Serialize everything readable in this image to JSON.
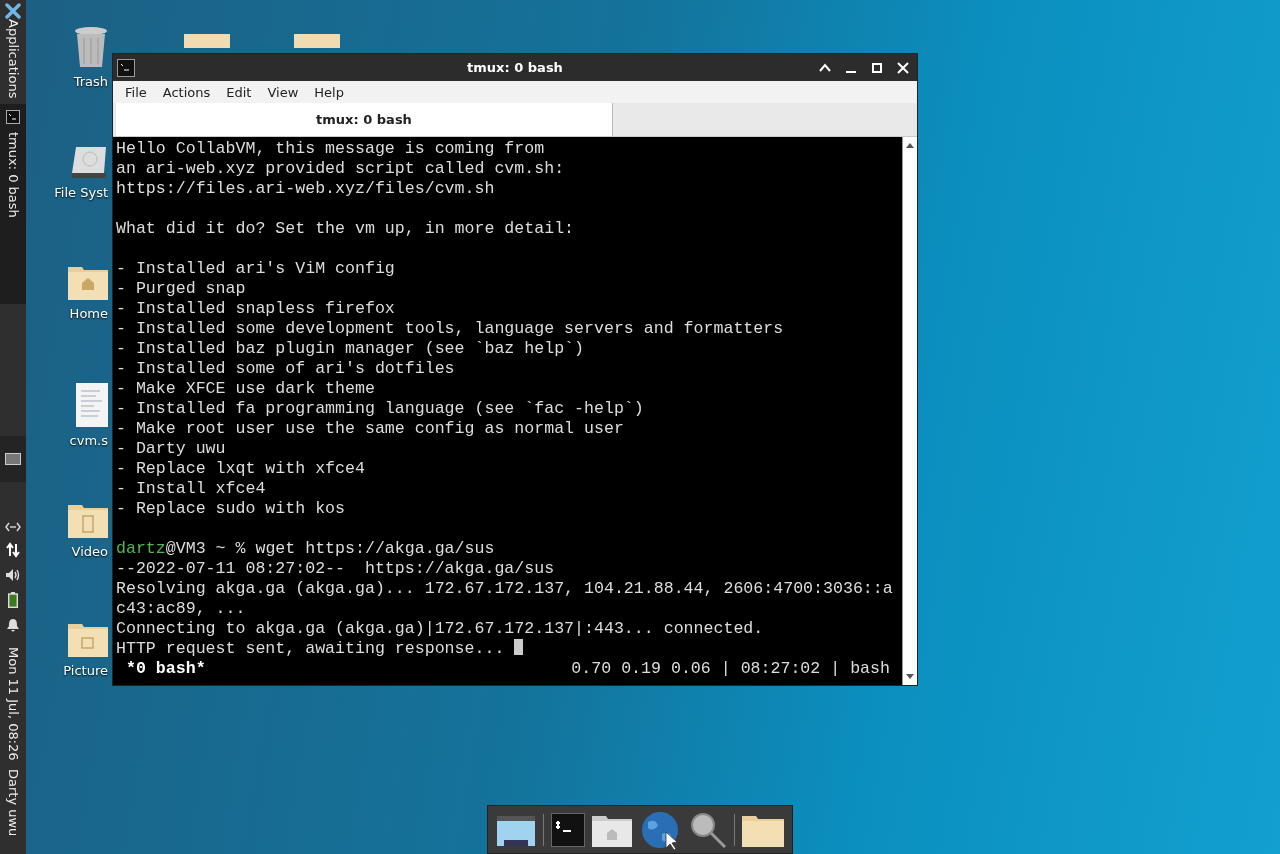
{
  "panel": {
    "menu_label": "Applications",
    "task_label": "tmux: 0 bash",
    "clock": "Mon 11 Jul, 08:26",
    "user": "Darty uwu"
  },
  "desktop_icons": [
    {
      "kind": "trash",
      "label": "Trash"
    },
    {
      "kind": "drive",
      "label": "File Syst"
    },
    {
      "kind": "home",
      "label": "Home"
    },
    {
      "kind": "document",
      "label": "cvm.s"
    },
    {
      "kind": "videos",
      "label": "Video"
    },
    {
      "kind": "pictures",
      "label": "Picture"
    }
  ],
  "window": {
    "title": "tmux: 0 bash",
    "menu": [
      "File",
      "Actions",
      "Edit",
      "View",
      "Help"
    ],
    "tabs": [
      {
        "label": "tmux: 0 bash",
        "selected": true
      }
    ]
  },
  "terminal": {
    "lines": [
      {
        "kind": "text",
        "text": "Hello CollabVM, this message is coming from"
      },
      {
        "kind": "text",
        "text": "an ari-web.xyz provided script called cvm.sh:"
      },
      {
        "kind": "text",
        "text": "https://files.ari-web.xyz/files/cvm.sh"
      },
      {
        "kind": "blank"
      },
      {
        "kind": "text",
        "text": "What did it do? Set the vm up, in more detail:"
      },
      {
        "kind": "blank"
      },
      {
        "kind": "text",
        "text": "- Installed ari's ViM config"
      },
      {
        "kind": "text",
        "text": "- Purged snap"
      },
      {
        "kind": "text",
        "text": "- Installed snapless firefox"
      },
      {
        "kind": "text",
        "text": "- Installed some development tools, language servers and formatters"
      },
      {
        "kind": "text",
        "text": "- Installed baz plugin manager (see `baz help`)"
      },
      {
        "kind": "text",
        "text": "- Installed some of ari's dotfiles"
      },
      {
        "kind": "text",
        "text": "- Make XFCE use dark theme"
      },
      {
        "kind": "text",
        "text": "- Installed fa programming language (see `fac -help`)"
      },
      {
        "kind": "text",
        "text": "- Make root user use the same config as normal user"
      },
      {
        "kind": "text",
        "text": "- Darty uwu"
      },
      {
        "kind": "text",
        "text": "- Replace lxqt with xfce4"
      },
      {
        "kind": "text",
        "text": "- Install xfce4"
      },
      {
        "kind": "text",
        "text": "- Replace sudo with kos"
      },
      {
        "kind": "blank"
      },
      {
        "kind": "prompt",
        "user": "dartz",
        "text": "@VM3 ~ % wget https://akga.ga/sus"
      },
      {
        "kind": "text",
        "text": "--2022-07-11 08:27:02--  https://akga.ga/sus"
      },
      {
        "kind": "text",
        "text": "Resolving akga.ga (akga.ga)... 172.67.172.137, 104.21.88.44, 2606:4700:3036::a"
      },
      {
        "kind": "text",
        "text": "c43:ac89, ..."
      },
      {
        "kind": "text",
        "text": "Connecting to akga.ga (akga.ga)|172.67.172.137|:443... connected."
      },
      {
        "kind": "cursor",
        "text": "HTTP request sent, awaiting response... "
      }
    ],
    "status_left": "*0 bash*",
    "status_right": "0.70 0.19 0.06 | 08:27:02 | bash"
  }
}
